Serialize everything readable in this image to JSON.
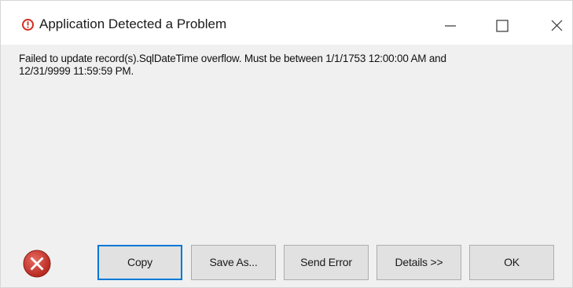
{
  "window": {
    "title": "Application Detected a Problem",
    "title_icon": "warning-circle-icon",
    "controls": {
      "minimize_icon": "minimize-icon",
      "maximize_icon": "maximize-icon",
      "close_icon": "close-icon"
    }
  },
  "message": {
    "line1": "Failed to update record(s).SqlDateTime overflow. Must be between 1/1/1753 12:00:00 AM and",
    "line2": "12/31/9999 11:59:59 PM."
  },
  "footer": {
    "error_icon": "error-x-icon",
    "buttons": {
      "copy": "Copy",
      "save_as": "Save As...",
      "send_error": "Send Error",
      "details": "Details >>",
      "ok": "OK"
    }
  },
  "colors": {
    "title_icon_red": "#d42a1f",
    "error_icon_red": "#c9332a",
    "default_button_border": "#0078d7",
    "button_face": "#e1e1e1",
    "dialog_background": "#f0f0f0"
  }
}
